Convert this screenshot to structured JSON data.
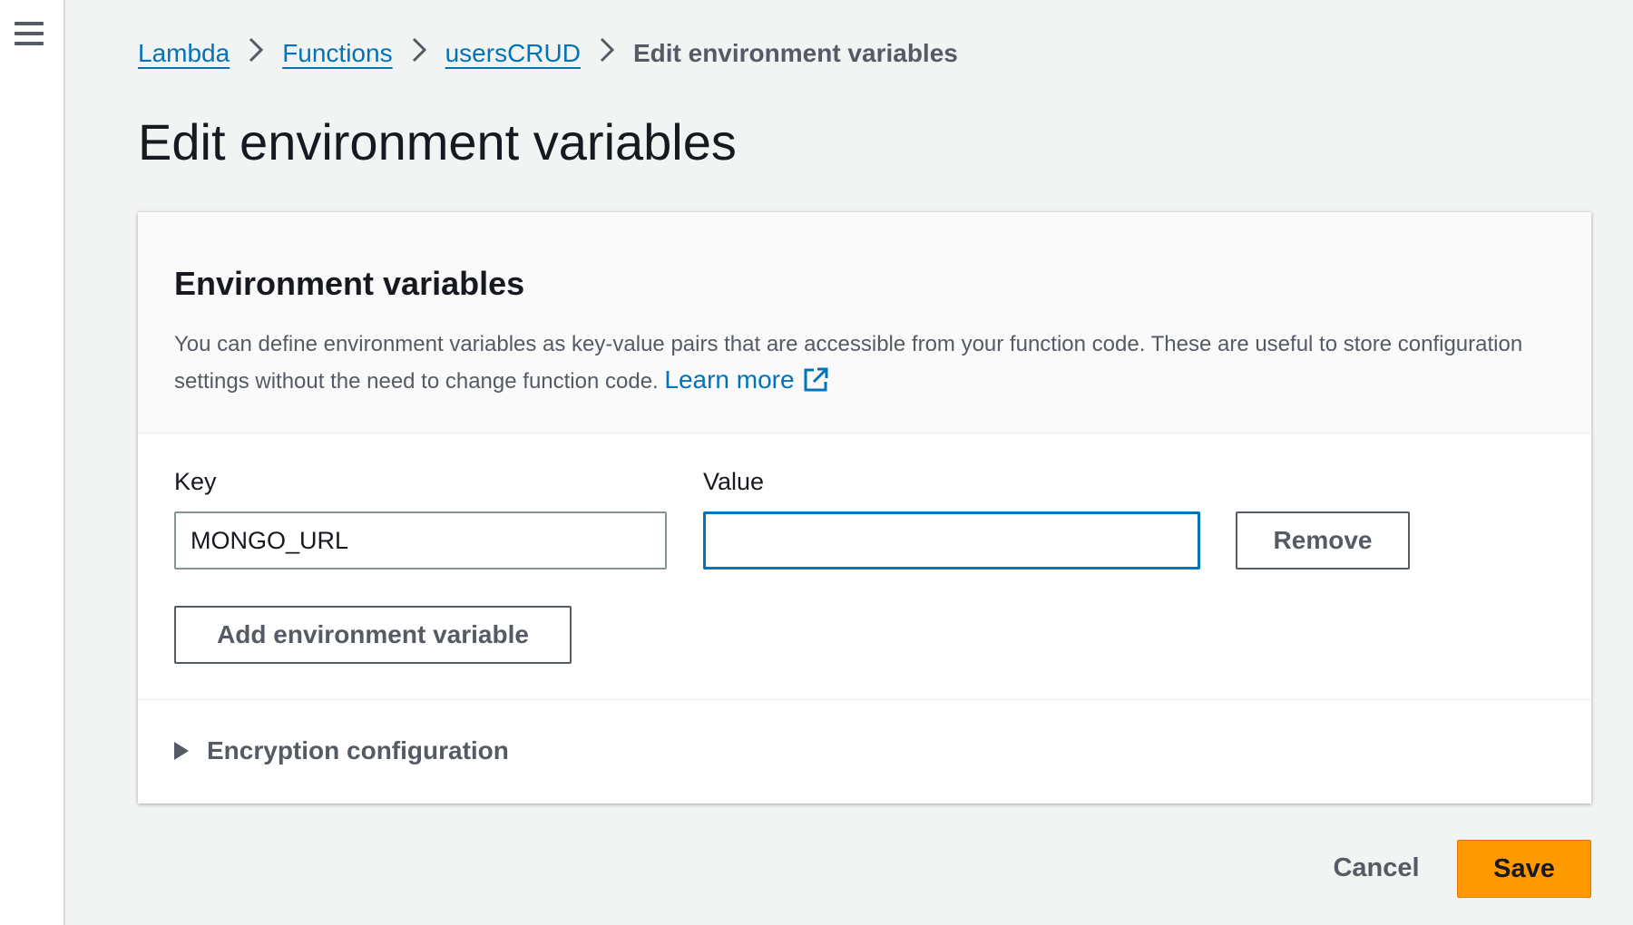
{
  "nav": {
    "menu_icon": "hamburger-menu-icon"
  },
  "breadcrumb": {
    "items": [
      {
        "label": "Lambda"
      },
      {
        "label": "Functions"
      },
      {
        "label": "usersCRUD"
      }
    ],
    "current": "Edit environment variables",
    "separator_icon": "chevron-right-icon"
  },
  "page": {
    "title": "Edit environment variables"
  },
  "panel": {
    "title": "Environment variables",
    "description": "You can define environment variables as key-value pairs that are accessible from your function code. These are useful to store configuration settings without the need to change function code.",
    "learn_more": "Learn more",
    "external_icon": "external-link-icon"
  },
  "form": {
    "key_label": "Key",
    "value_label": "Value",
    "rows": [
      {
        "key": "MONGO_URL",
        "value": ""
      }
    ],
    "remove_label": "Remove",
    "add_label": "Add environment variable"
  },
  "encryption": {
    "label": "Encryption configuration",
    "expanded": false,
    "icon": "caret-right-icon"
  },
  "footer": {
    "cancel_label": "Cancel",
    "save_label": "Save"
  },
  "colors": {
    "accent": "#0073bb",
    "primary_button": "#ff9900",
    "text_secondary": "#545b64"
  }
}
